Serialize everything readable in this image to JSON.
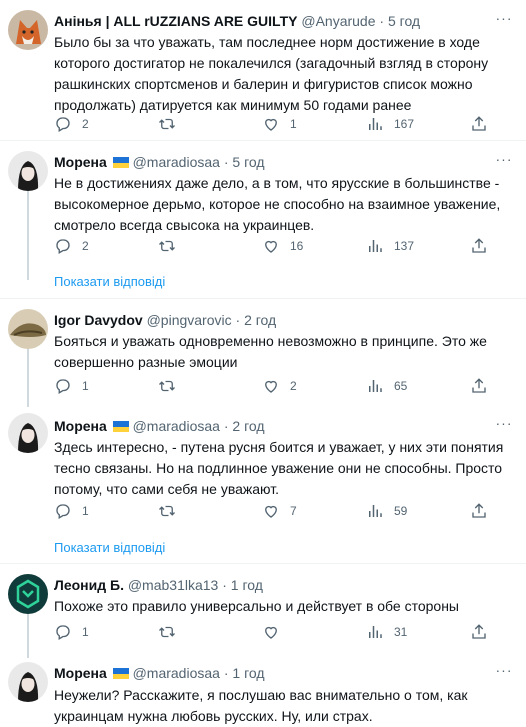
{
  "tweets": [
    {
      "name": "Анінья | ALL rUZZIANS ARE GUILTY",
      "handle": "@Anyarude",
      "sep": "·",
      "time": "5 год",
      "text": "Было бы за что уважать, там последнее норм достижение в ходе которого достигатор не покалечился (загадочный взгляд в сторону рашкинских спортсменов и балерин и фигуристов список можно продолжать) датируется как минимум 50 годами ранее",
      "replies": "2",
      "retweets": "",
      "likes": "1",
      "views": "167"
    },
    {
      "name": "Морена",
      "handle": "@maradiosaa",
      "sep": "·",
      "time": "5 год",
      "text": "Не в достижениях даже дело, а в том, что ярусские в большинстве - высокомерное дерьмо, которое не способно на взаимное уважение, смотрело всегда свысока на украинцев.",
      "replies": "2",
      "retweets": "",
      "likes": "16",
      "views": "137"
    },
    {
      "name": "Igor Davydov",
      "handle": "@pingvarovic",
      "sep": "·",
      "time": "2 год",
      "text": "Бояться и уважать одновременно невозможно в принципе. Это же совершенно разные эмоции",
      "replies": "1",
      "retweets": "",
      "likes": "2",
      "views": "65"
    },
    {
      "name": "Морена",
      "handle": "@maradiosaa",
      "sep": "·",
      "time": "2 год",
      "text": "Здесь интересно, - путена русня боится и уважает, у них эти понятия тесно связаны. Но на подлинное уважение они не способны. Просто потому, что сами себя не уважают.",
      "replies": "1",
      "retweets": "",
      "likes": "7",
      "views": "59"
    },
    {
      "name": "Леонид Б.",
      "handle": "@mab31lka13",
      "sep": "·",
      "time": "1 год",
      "text": "Похоже это правило универсально и действует в обе стороны",
      "replies": "1",
      "retweets": "",
      "likes": "",
      "views": "31"
    },
    {
      "name": "Морена",
      "handle": "@maradiosaa",
      "sep": "·",
      "time": "1 год",
      "text": "Неужели? Расскажите, я послушаю вас внимательно о том, как украинцам нужна любовь русских. Ну, или страх."
    }
  ],
  "show_replies": "Показати відповіді",
  "colors": {
    "accent": "#1d9bf0",
    "muted": "#536471",
    "divider": "#eff3f4",
    "flag_blue": "#1d72d6",
    "flag_yellow": "#ffd23c"
  },
  "icons": [
    "reply-icon",
    "retweet-icon",
    "like-icon",
    "views-icon",
    "share-icon",
    "more-icon",
    "ukraine-flag-icon"
  ]
}
